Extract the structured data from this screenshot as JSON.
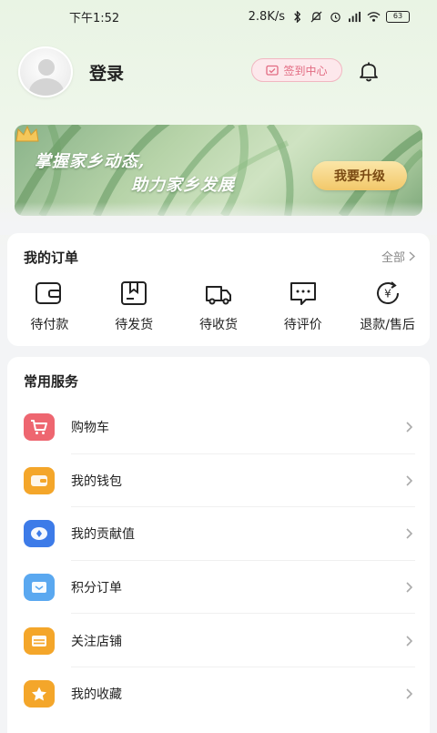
{
  "status_bar": {
    "time": "下午1:52",
    "net_speed": "2.8K/s",
    "battery": "63"
  },
  "profile": {
    "login_label": "登录",
    "checkin_label": "签到中心"
  },
  "banner": {
    "line1": "掌握家乡动态,",
    "line2": "助力家乡发展",
    "upgrade_label": "我要升级"
  },
  "orders": {
    "title": "我的订单",
    "see_all": "全部",
    "items": [
      {
        "label": "待付款",
        "icon": "wallet-icon"
      },
      {
        "label": "待发货",
        "icon": "package-icon"
      },
      {
        "label": "待收货",
        "icon": "truck-icon"
      },
      {
        "label": "待评价",
        "icon": "comment-icon"
      },
      {
        "label": "退款/售后",
        "icon": "refund-icon"
      }
    ]
  },
  "services": {
    "title": "常用服务",
    "items": [
      {
        "label": "购物车",
        "icon": "cart-icon",
        "color": "#ee6670"
      },
      {
        "label": "我的钱包",
        "icon": "wallet-icon",
        "color": "#f4a62a"
      },
      {
        "label": "我的贡献值",
        "icon": "diamond-icon",
        "color": "#3d7be8"
      },
      {
        "label": "积分订单",
        "icon": "mail-icon",
        "color": "#5aa8f0"
      },
      {
        "label": "关注店铺",
        "icon": "store-icon",
        "color": "#f4a62a"
      },
      {
        "label": "我的收藏",
        "icon": "star-icon",
        "color": "#f4a62a"
      }
    ]
  }
}
